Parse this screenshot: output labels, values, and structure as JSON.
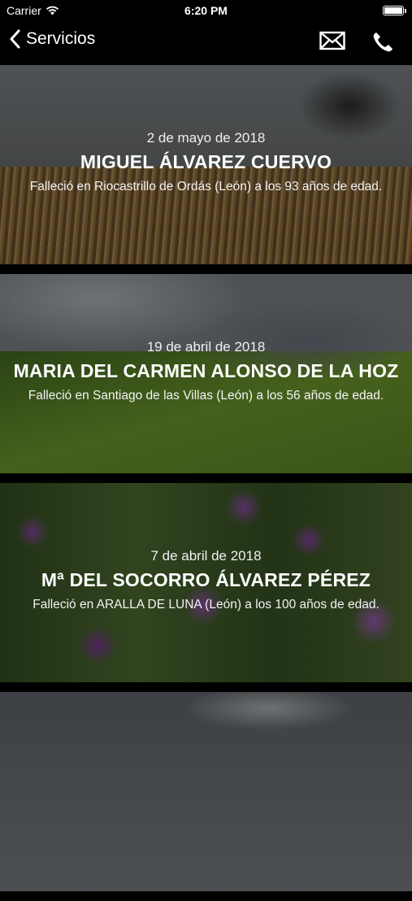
{
  "status_bar": {
    "carrier": "Carrier",
    "time": "6:20 PM"
  },
  "nav": {
    "back_label": "Servicios"
  },
  "items": [
    {
      "date": "2 de mayo de 2018",
      "name": "MIGUEL ÁLVAREZ CUERVO",
      "desc": "Falleció en Riocastrillo de Ordás (León) a los 93 años de edad."
    },
    {
      "date": "19 de abril de 2018",
      "name": "MARIA DEL CARMEN ALONSO DE LA HOZ",
      "desc": "Falleció en Santiago de las Villas (León) a los 56 años de edad."
    },
    {
      "date": "7 de abril de 2018",
      "name": "Mª DEL SOCORRO ÁLVAREZ PÉREZ",
      "desc": "Falleció en ARALLA DE LUNA (León) a los 100 años de edad."
    }
  ]
}
